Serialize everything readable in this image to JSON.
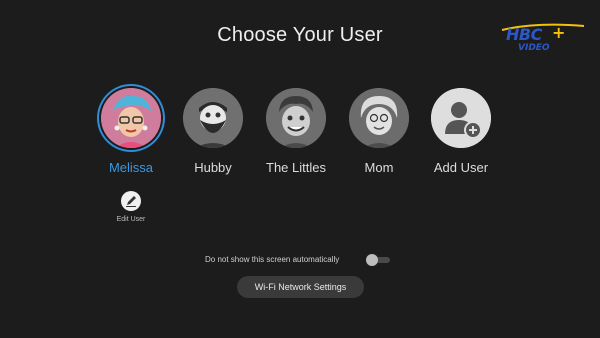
{
  "header": {
    "title": "Choose Your User"
  },
  "logo": {
    "text": "HBC",
    "plus": "+",
    "sub": "VIDEO"
  },
  "users": [
    {
      "name": "Melissa",
      "selected": true
    },
    {
      "name": "Hubby",
      "selected": false
    },
    {
      "name": "The Littles",
      "selected": false
    },
    {
      "name": "Mom",
      "selected": false
    },
    {
      "name": "Add User",
      "selected": false
    }
  ],
  "edit": {
    "label": "Edit User"
  },
  "auto_screen": {
    "label": "Do not show this screen automatically",
    "enabled": false
  },
  "wifi": {
    "label": "Wi-Fi Network Settings"
  },
  "colors": {
    "accent": "#2e8fd6",
    "background": "#1c1c1c",
    "brand_blue": "#2b57c7",
    "brand_yellow": "#f4c20d"
  }
}
